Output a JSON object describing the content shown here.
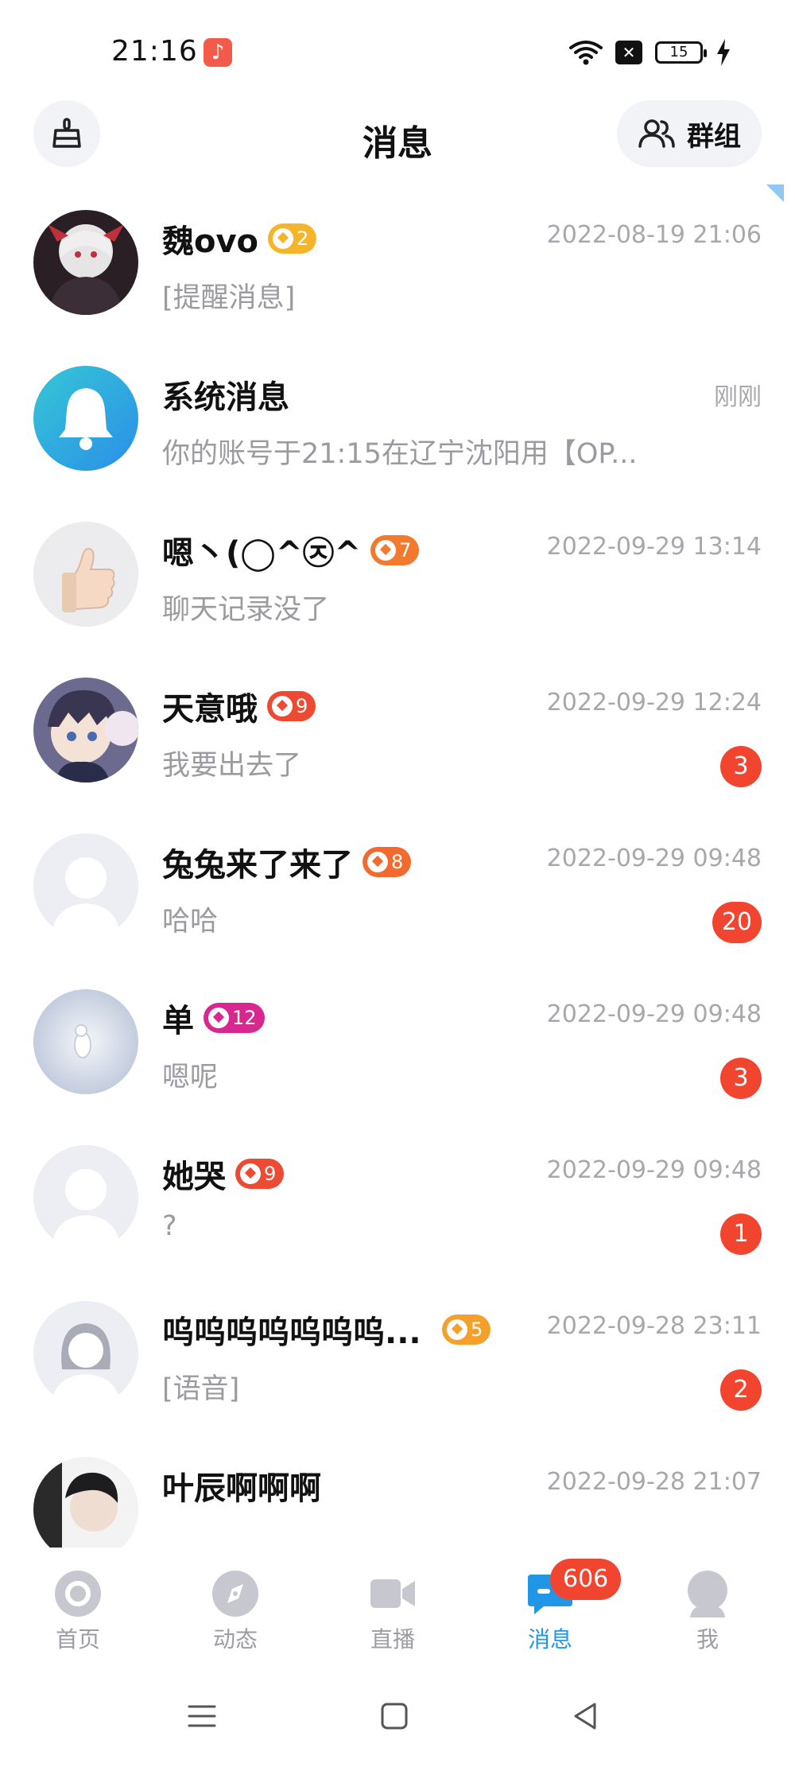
{
  "status_bar": {
    "time": "21:16",
    "battery": "15"
  },
  "header": {
    "title": "消息",
    "groups_label": "群组",
    "left_icon": "broom-icon",
    "groups_icon": "people-icon"
  },
  "conversations": [
    {
      "name": "魏ovo",
      "level": "2",
      "level_color": "#f5b52a",
      "time": "2022-08-19 21:06",
      "preview": "[提醒消息]",
      "unread": ""
    },
    {
      "name": "系统消息",
      "level": "",
      "level_color": "",
      "time": "刚刚",
      "preview": "你的账号于21:15在辽宁沈阳用【OP...",
      "unread": ""
    },
    {
      "name": "嗯丶(◯^㉨^",
      "level": "7",
      "level_color": "#f27a2e",
      "time": "2022-09-29 13:14",
      "preview": "聊天记录没了",
      "unread": ""
    },
    {
      "name": "天意哦",
      "level": "9",
      "level_color": "#ec4a32",
      "time": "2022-09-29 12:24",
      "preview": "我要出去了",
      "unread": "3"
    },
    {
      "name": "兔兔来了来了",
      "level": "8",
      "level_color": "#f26a2e",
      "time": "2022-09-29 09:48",
      "preview": "哈哈",
      "unread": "20"
    },
    {
      "name": "单",
      "level": "12",
      "level_color": "#d8278e",
      "time": "2022-09-29 09:48",
      "preview": "嗯呢",
      "unread": "3"
    },
    {
      "name": "她哭",
      "level": "9",
      "level_color": "#ec4a32",
      "time": "2022-09-29 09:48",
      "preview": "?",
      "unread": "1"
    },
    {
      "name": "呜呜呜呜呜呜呜...",
      "level": "5",
      "level_color": "#f5a02a",
      "time": "2022-09-28 23:11",
      "preview": "[语音]",
      "unread": "2"
    },
    {
      "name": "叶辰啊啊啊",
      "level": "",
      "level_color": "",
      "time": "2022-09-28 21:07",
      "preview": "",
      "unread": ""
    }
  ],
  "tabs": [
    {
      "label": "首页",
      "icon": "home-icon"
    },
    {
      "label": "动态",
      "icon": "compass-icon"
    },
    {
      "label": "直播",
      "icon": "video-camera-icon"
    },
    {
      "label": "消息",
      "icon": "chat-icon",
      "badge": "606"
    },
    {
      "label": "我",
      "icon": "profile-icon"
    }
  ],
  "colors": {
    "accent": "#2196e6",
    "unread": "#f2452f",
    "muted_text": "#a7a7ad"
  }
}
